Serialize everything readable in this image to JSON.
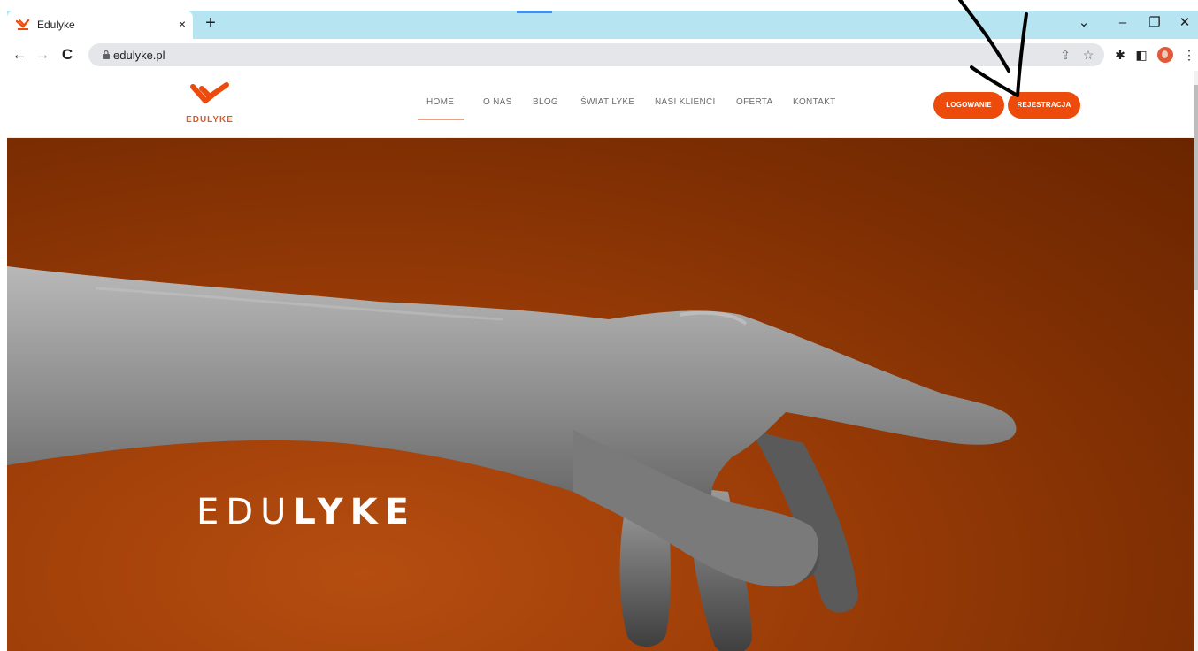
{
  "browser": {
    "tab_title": "Edulyke",
    "tab_close": "×",
    "new_tab": "+",
    "window_controls": {
      "dropdown": "⌄",
      "minimize": "–",
      "maximize": "❐",
      "close": "✕"
    },
    "nav": {
      "back": "←",
      "forward": "→",
      "reload": "C"
    },
    "url": "edulyke.pl",
    "icons": [
      "share-icon",
      "star-icon",
      "extensions-icon",
      "sidepanel-icon",
      "profile-avatar-icon",
      "menu-icon"
    ],
    "share_icon": "⇪",
    "star_icon": "☆",
    "puzzle_icon": "✱",
    "sidepanel_icon": "◧",
    "menu_icon": "⋮"
  },
  "site": {
    "logo_text": "EDULYKE",
    "brand_color": "#ec4b0c",
    "nav_items": [
      {
        "label": "HOME",
        "active": true
      },
      {
        "label": "O NAS"
      },
      {
        "label": "BLOG"
      },
      {
        "label": "ŚWIAT LYKE"
      },
      {
        "label": "NASI KLIENCI"
      },
      {
        "label": "OFERTA"
      },
      {
        "label": "KONTAKT"
      }
    ],
    "login_button": "LOGOWANIE",
    "register_button": "REJESTRACJA"
  },
  "hero": {
    "title_light": "EDU",
    "title_bold": "LYKE",
    "background_color": "#9e3e08"
  }
}
